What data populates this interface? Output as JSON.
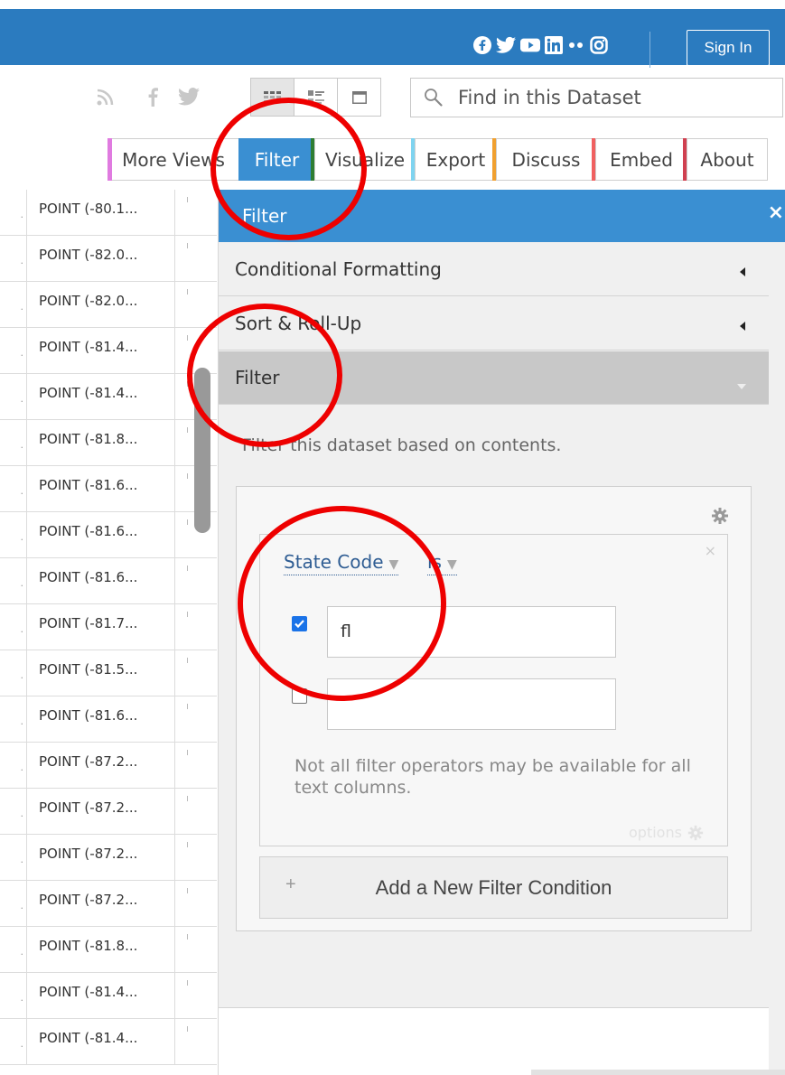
{
  "topbar": {
    "social_icons": [
      "facebook-icon",
      "twitter-icon",
      "youtube-icon",
      "linkedin-icon",
      "flickr-icon",
      "instagram-icon"
    ],
    "sign_in": "Sign In",
    "bg_color": "#2b7bbf"
  },
  "toolbar": {
    "share_icons": [
      "rss-icon",
      "facebook-icon",
      "twitter-icon"
    ],
    "view_modes": [
      "grid-view-icon",
      "list-view-icon",
      "page-view-icon"
    ],
    "active_view": "grid-view-icon",
    "search_placeholder": "Find in this Dataset"
  },
  "tabs": [
    {
      "label": "More Views",
      "color": "#e07be0",
      "active": false
    },
    {
      "label": "Filter",
      "color": "#2e7d32",
      "active": true
    },
    {
      "label": "Visualize",
      "color": "#7fd4f0",
      "active": false
    },
    {
      "label": "Export",
      "color": "#f0a030",
      "active": false
    },
    {
      "label": "Discuss",
      "color": "#f06060",
      "active": false
    },
    {
      "label": "Embed",
      "color": "#d04050",
      "active": false
    },
    {
      "label": "About",
      "color": "#d04050",
      "active": false
    }
  ],
  "table": {
    "rows": [
      "POINT (-80.1...",
      "POINT (-82.0...",
      "POINT (-82.0...",
      "POINT (-81.4...",
      "POINT (-81.4...",
      "POINT (-81.8...",
      "POINT (-81.6...",
      "POINT (-81.6...",
      "POINT (-81.6...",
      "POINT (-81.7...",
      "POINT (-81.5...",
      "POINT (-81.6...",
      "POINT (-87.2...",
      "POINT (-87.2...",
      "POINT (-87.2...",
      "POINT (-87.2...",
      "POINT (-81.8...",
      "POINT (-81.4...",
      "POINT (-81.4..."
    ]
  },
  "panel": {
    "title": "Filter",
    "close": "×",
    "sections": [
      {
        "label": "Conditional Formatting",
        "arrow": "◀",
        "active": false
      },
      {
        "label": "Sort & Roll-Up",
        "arrow": "◀",
        "active": false
      },
      {
        "label": "Filter",
        "arrow": "▼",
        "active": true
      }
    ],
    "description": "Filter this dataset based on contents.",
    "condition": {
      "column": "State Code",
      "operator": "is",
      "values": [
        {
          "checked": true,
          "value": "fl"
        },
        {
          "checked": false,
          "value": ""
        }
      ],
      "note": "Not all filter operators may be available for all text columns.",
      "options_label": "options",
      "remove": "×"
    },
    "add_condition": {
      "plus": "+",
      "label": "Add a New Filter Condition"
    }
  },
  "annotation_color": "#ee0000"
}
